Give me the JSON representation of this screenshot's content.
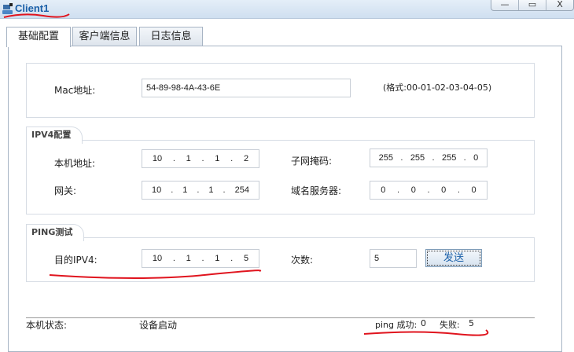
{
  "window": {
    "title": "Client1",
    "minimize": "—",
    "maximize": "▭",
    "close": "X"
  },
  "tabs": [
    {
      "label": "基础配置"
    },
    {
      "label": "客户端信息"
    },
    {
      "label": "日志信息"
    }
  ],
  "mac": {
    "label": "Mac地址:",
    "value": "54-89-98-4A-43-6E",
    "hint": "(格式:00-01-02-03-04-05)"
  },
  "ipv4": {
    "section": "IPV4配置",
    "local_label": "本机地址:",
    "local": [
      "10",
      "1",
      "1",
      "2"
    ],
    "mask_label": "子网掩码:",
    "mask": [
      "255",
      "255",
      "255",
      "0"
    ],
    "gateway_label": "网关:",
    "gateway": [
      "10",
      "1",
      "1",
      "254"
    ],
    "dns_label": "域名服务器:",
    "dns": [
      "0",
      "0",
      "0",
      "0"
    ]
  },
  "ping": {
    "section": "PING测试",
    "dest_label": "目的IPV4:",
    "dest": [
      "10",
      "1",
      "1",
      "5"
    ],
    "count_label": "次数:",
    "count": "5",
    "send": "发送"
  },
  "status": {
    "label": "本机状态:",
    "value": "设备启动",
    "ping_success_label": "ping 成功:",
    "success": "0",
    "fail_label": "失败:",
    "fail": "5"
  },
  "colors": {
    "title": "#1a5fa8",
    "annotation": "#e0141e"
  }
}
